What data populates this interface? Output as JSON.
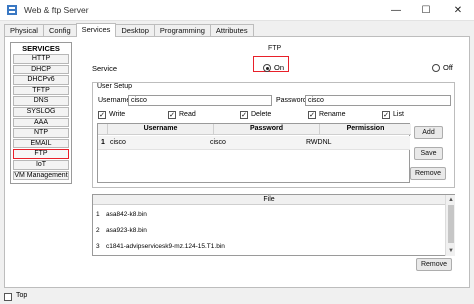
{
  "window": {
    "title": "Web & ftp Server",
    "min_glyph": "—",
    "max_glyph": "☐",
    "close_glyph": "✕"
  },
  "tabs": [
    "Physical",
    "Config",
    "Services",
    "Desktop",
    "Programming",
    "Attributes"
  ],
  "services": {
    "header": "SERVICES",
    "items": [
      "HTTP",
      "DHCP",
      "DHCPv6",
      "TFTP",
      "DNS",
      "SYSLOG",
      "AAA",
      "NTP",
      "EMAIL",
      "FTP",
      "IoT",
      "VM Management"
    ],
    "active": "FTP"
  },
  "ftp": {
    "title": "FTP",
    "service_label": "Service",
    "on_label": "On",
    "off_label": "Off",
    "service_state": "On"
  },
  "user_setup": {
    "group_label": "User Setup",
    "username_label": "Username",
    "username_value": "cisco",
    "password_label": "Password",
    "password_value": "cisco",
    "permissions": [
      {
        "label": "Write",
        "checked": true
      },
      {
        "label": "Read",
        "checked": true
      },
      {
        "label": "Delete",
        "checked": true
      },
      {
        "label": "Rename",
        "checked": true
      },
      {
        "label": "List",
        "checked": true
      }
    ],
    "table": {
      "headers": [
        "Username",
        "Password",
        "Permission"
      ],
      "rows": [
        {
          "index": "1",
          "username": "cisco",
          "password": "cisco",
          "permission": "RWDNL"
        }
      ]
    },
    "buttons": {
      "add": "Add",
      "save": "Save",
      "remove": "Remove"
    }
  },
  "files": {
    "header": "File",
    "items": [
      {
        "index": "1",
        "name": "asa842-k8.bin"
      },
      {
        "index": "2",
        "name": "asa923-k8.bin"
      },
      {
        "index": "3",
        "name": "c1841-advipservicesk9-mz.124-15.T1.bin"
      }
    ],
    "remove_button": "Remove"
  },
  "bottom": {
    "label": "Top"
  },
  "check_glyph": "✓",
  "colors": {
    "highlight_red": "#e8202a"
  }
}
